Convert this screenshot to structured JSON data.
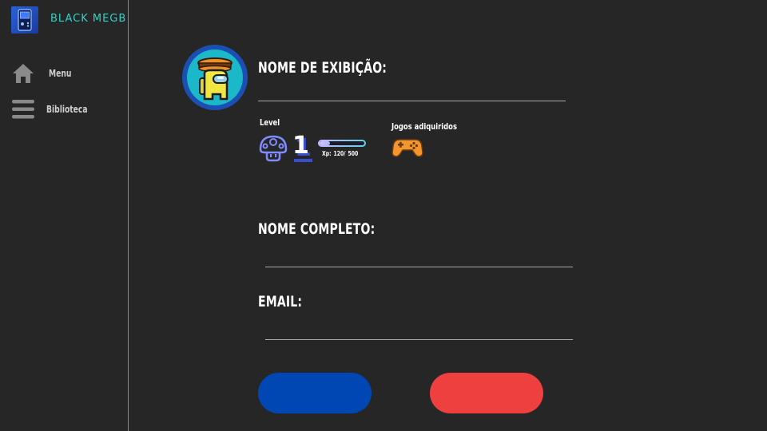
{
  "app": {
    "brand_name": "BLACK MEGB",
    "brand_icon": "handheld-console-icon",
    "brand_color": "#2fd4c7"
  },
  "sidebar": {
    "items": [
      {
        "label": "Menu",
        "icon": "home-icon"
      },
      {
        "label": "Biblioteca",
        "icon": "hamburger-menu-icon"
      }
    ]
  },
  "profile": {
    "avatar_icon": "crewmate-avatar-icon",
    "display_name_label": "NOME DE EXIBIÇÃO:",
    "display_name_value": "",
    "level_label": "Level",
    "level_value": "1",
    "level_icon": "mushroom-icon",
    "xp_text": "Xp:  120/ 500",
    "xp_fraction": 0.24,
    "games_label": "Jogos adiquiridos",
    "games_icon": "gamepad-icon",
    "full_name_label": "NOME COMPLETO:",
    "full_name_value": "",
    "email_label": "EMAIL:",
    "email_value": ""
  },
  "actions": {
    "save_label": "",
    "cancel_label": "",
    "save_color": "#0047b3",
    "cancel_color": "#ef4040"
  }
}
